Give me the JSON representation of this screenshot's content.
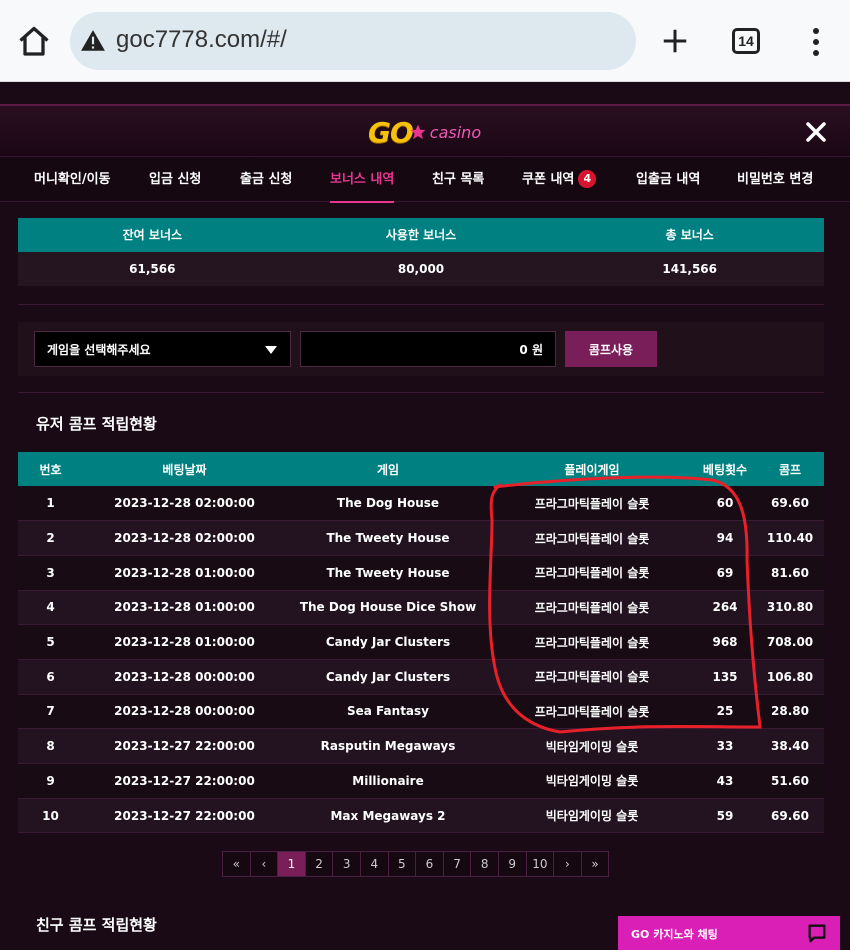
{
  "browser": {
    "url": "goc7778.com/#/",
    "tab_count": "14"
  },
  "logo": {
    "go": "GO",
    "casino": "casino"
  },
  "tabs": [
    {
      "label": "머니확인/이동"
    },
    {
      "label": "입금 신청"
    },
    {
      "label": "출금 신청"
    },
    {
      "label": "보너스 내역"
    },
    {
      "label": "친구 목록"
    },
    {
      "label": "쿠폰 내역",
      "badge": "4"
    },
    {
      "label": "입출금 내역"
    },
    {
      "label": "비밀번호 변경"
    }
  ],
  "bonus": {
    "headers": [
      "잔여 보너스",
      "사용한 보너스",
      "총 보너스"
    ],
    "values": [
      "61,566",
      "80,000",
      "141,566"
    ]
  },
  "comp": {
    "select_placeholder": "게임을 선택해주세요",
    "amount": "0 원",
    "use_label": "콤프사용"
  },
  "user_section_title": "유저 콤프 적립현황",
  "friend_section_title": "친구 콤프 적립현황",
  "table": {
    "headers": [
      "번호",
      "베팅날짜",
      "게임",
      "플레이게임",
      "베팅횟수",
      "콤프"
    ],
    "rows": [
      [
        "1",
        "2023-12-28 02:00:00",
        "The Dog House",
        "프라그마틱플레이 슬롯",
        "60",
        "69.60"
      ],
      [
        "2",
        "2023-12-28 02:00:00",
        "The Tweety House",
        "프라그마틱플레이 슬롯",
        "94",
        "110.40"
      ],
      [
        "3",
        "2023-12-28 01:00:00",
        "The Tweety House",
        "프라그마틱플레이 슬롯",
        "69",
        "81.60"
      ],
      [
        "4",
        "2023-12-28 01:00:00",
        "The Dog House Dice Show",
        "프라그마틱플레이 슬롯",
        "264",
        "310.80"
      ],
      [
        "5",
        "2023-12-28 01:00:00",
        "Candy Jar Clusters",
        "프라그마틱플레이 슬롯",
        "968",
        "708.00"
      ],
      [
        "6",
        "2023-12-28 00:00:00",
        "Candy Jar Clusters",
        "프라그마틱플레이 슬롯",
        "135",
        "106.80"
      ],
      [
        "7",
        "2023-12-28 00:00:00",
        "Sea Fantasy",
        "프라그마틱플레이 슬롯",
        "25",
        "28.80"
      ],
      [
        "8",
        "2023-12-27 22:00:00",
        "Rasputin Megaways",
        "빅타임게이밍 슬롯",
        "33",
        "38.40"
      ],
      [
        "9",
        "2023-12-27 22:00:00",
        "Millionaire",
        "빅타임게이밍 슬롯",
        "43",
        "51.60"
      ],
      [
        "10",
        "2023-12-27 22:00:00",
        "Max Megaways 2",
        "빅타임게이밍 슬롯",
        "59",
        "69.60"
      ]
    ]
  },
  "pager": [
    "«",
    "‹",
    "1",
    "2",
    "3",
    "4",
    "5",
    "6",
    "7",
    "8",
    "9",
    "10",
    "›",
    "»"
  ],
  "chat_label": "GO 카지노와 채팅",
  "colors": {
    "teal": "#008080",
    "accent_pink": "#e8358f",
    "button_magenta": "#7a1e5a",
    "logo_gold": "#f5c10a",
    "annotation_red": "#e8202a"
  }
}
